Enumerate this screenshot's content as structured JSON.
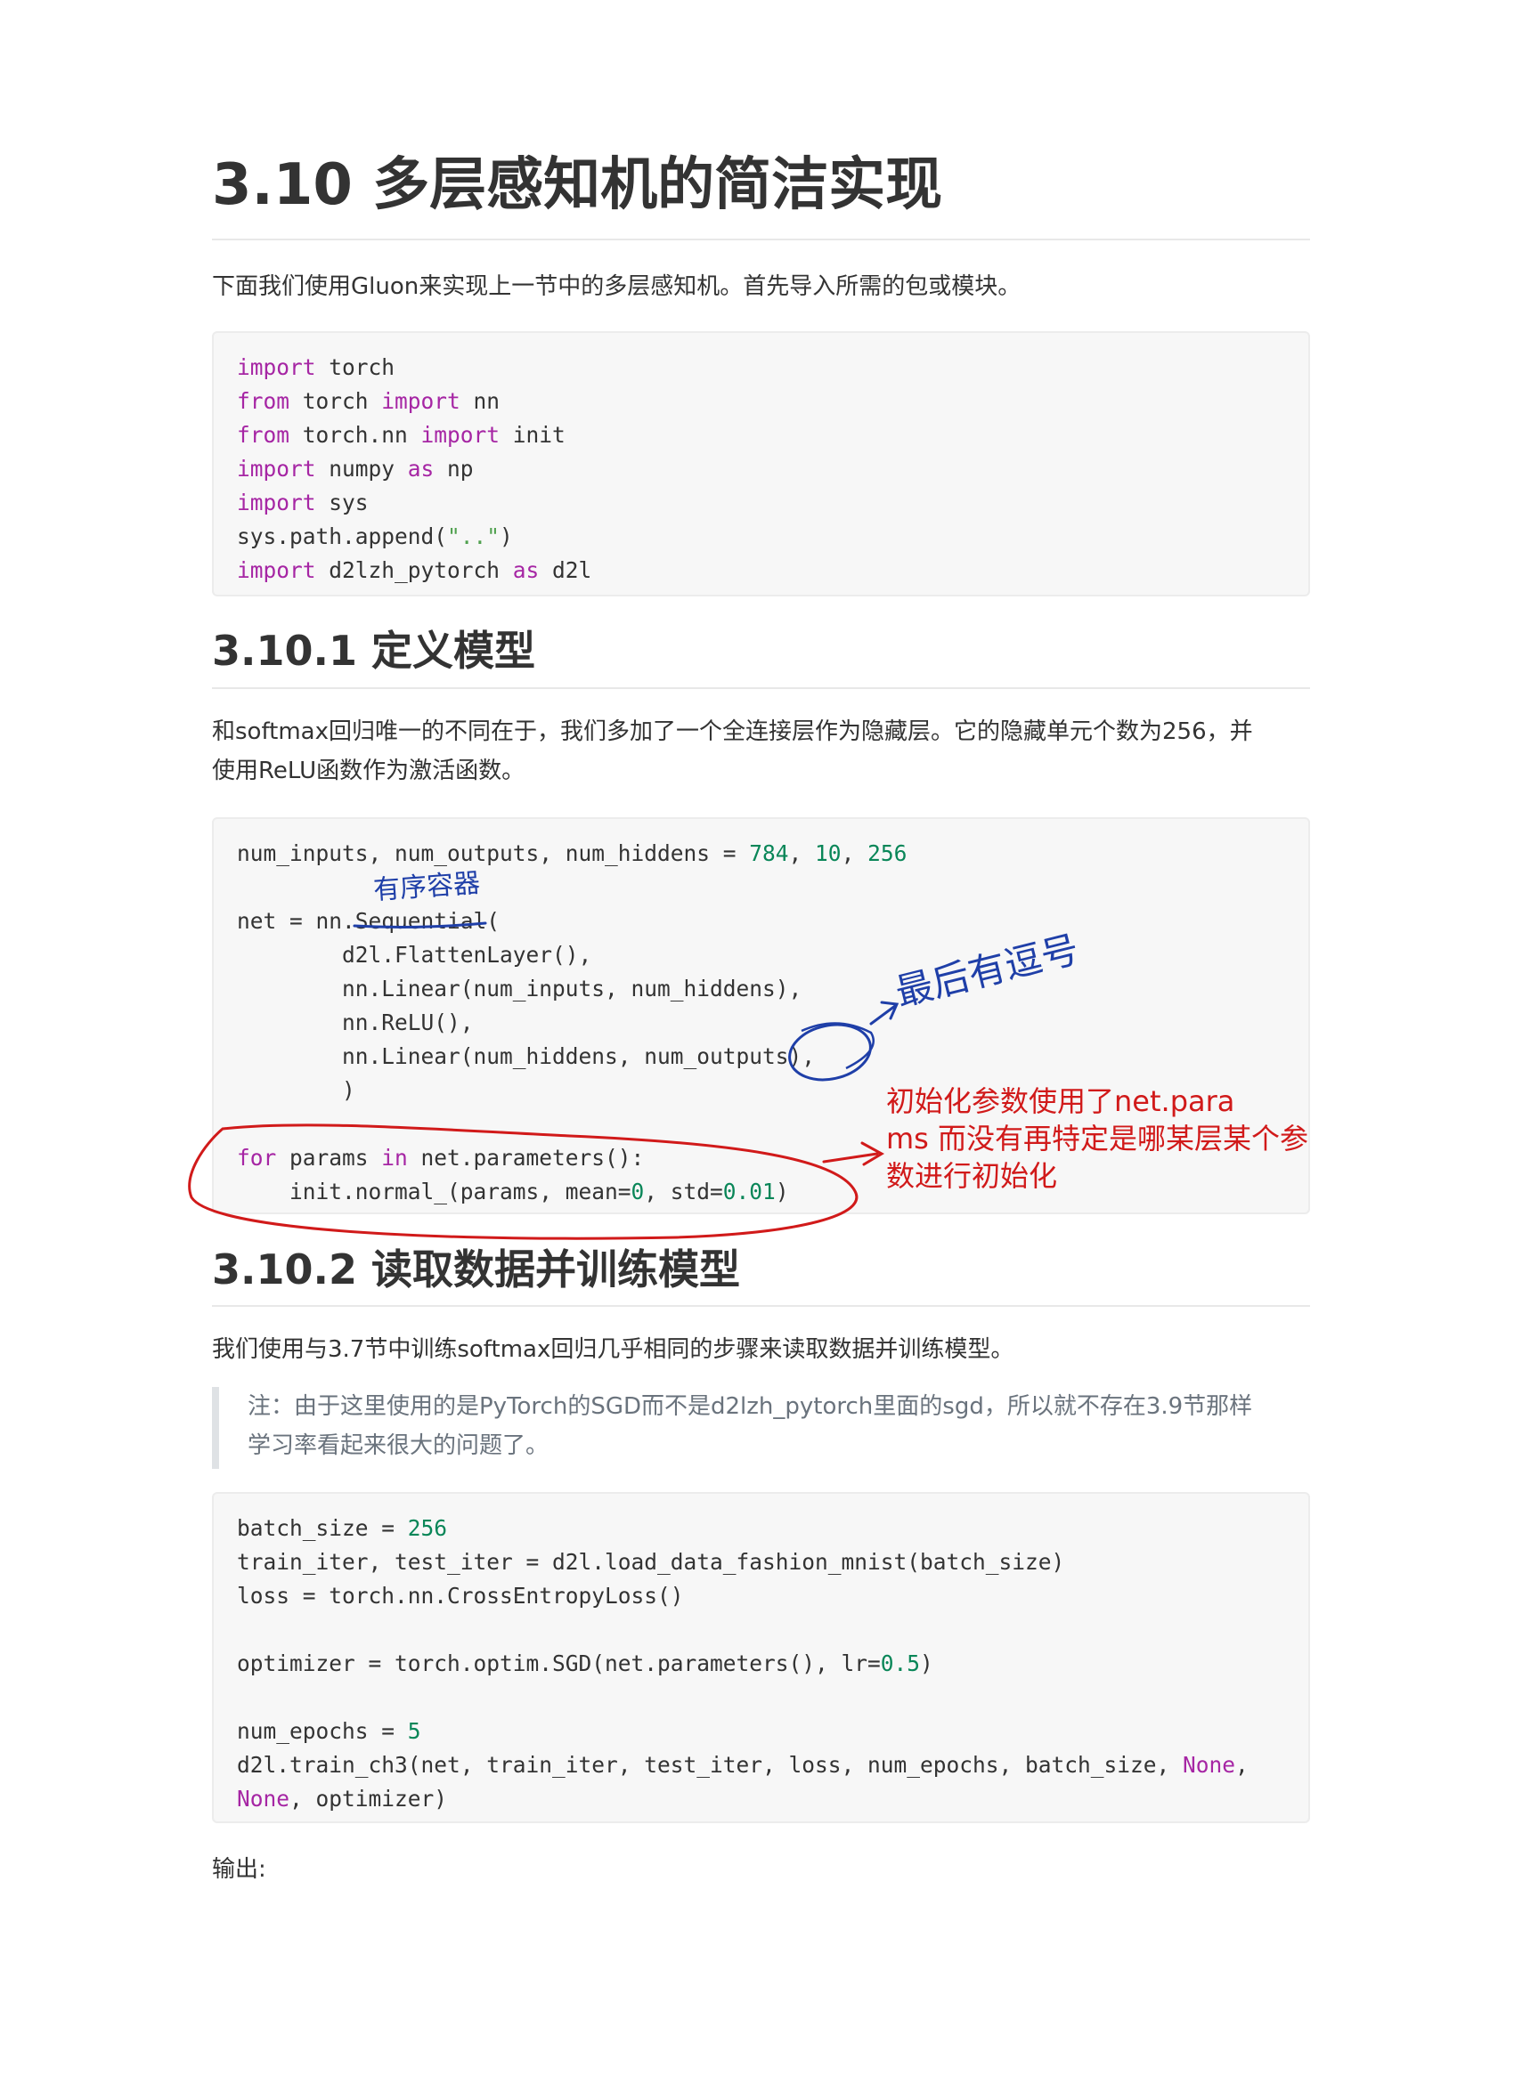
{
  "title": "3.10 多层感知机的简洁实现",
  "intro": "下面我们使用Gluon来实现上一节中的多层感知机。首先导入所需的包或模块。",
  "code_imports": [
    [
      {
        "t": "import",
        "c": "kw"
      },
      {
        "t": " torch"
      }
    ],
    [
      {
        "t": "from",
        "c": "kw"
      },
      {
        "t": " torch "
      },
      {
        "t": "import",
        "c": "kw"
      },
      {
        "t": " nn"
      }
    ],
    [
      {
        "t": "from",
        "c": "kw"
      },
      {
        "t": " torch.nn "
      },
      {
        "t": "import",
        "c": "kw"
      },
      {
        "t": " init"
      }
    ],
    [
      {
        "t": "import",
        "c": "kw"
      },
      {
        "t": " numpy "
      },
      {
        "t": "as",
        "c": "kw"
      },
      {
        "t": " np"
      }
    ],
    [
      {
        "t": "import",
        "c": "kw"
      },
      {
        "t": " sys"
      }
    ],
    [
      {
        "t": "sys.path.append("
      },
      {
        "t": "\"..\"",
        "c": "str"
      },
      {
        "t": ")"
      }
    ],
    [
      {
        "t": "import",
        "c": "kw"
      },
      {
        "t": " d2lzh_pytorch "
      },
      {
        "t": "as",
        "c": "kw"
      },
      {
        "t": " d2l"
      }
    ]
  ],
  "section1": {
    "heading": "3.10.1 定义模型",
    "text_line1": "和softmax回归唯一的不同在于，我们多加了一个全连接层作为隐藏层。它的隐藏单元个数为256，并",
    "text_line2": "使用ReLU函数作为激活函数。"
  },
  "code_model": [
    [
      {
        "t": "num_inputs, num_outputs, num_hiddens = "
      },
      {
        "t": "784",
        "c": "num"
      },
      {
        "t": ", "
      },
      {
        "t": "10",
        "c": "num"
      },
      {
        "t": ", "
      },
      {
        "t": "256",
        "c": "num"
      }
    ],
    [
      {
        "t": ""
      }
    ],
    [
      {
        "t": "net = nn.Sequential("
      }
    ],
    [
      {
        "t": "        d2l.FlattenLayer(),"
      }
    ],
    [
      {
        "t": "        nn.Linear(num_inputs, num_hiddens),"
      }
    ],
    [
      {
        "t": "        nn.ReLU(),"
      }
    ],
    [
      {
        "t": "        nn.Linear(num_hiddens, num_outputs),"
      }
    ],
    [
      {
        "t": "        )"
      }
    ],
    [
      {
        "t": ""
      }
    ],
    [
      {
        "t": "for",
        "c": "kw"
      },
      {
        "t": " params "
      },
      {
        "t": "in",
        "c": "kw"
      },
      {
        "t": " net.parameters():"
      }
    ],
    [
      {
        "t": "    init.normal_(params, mean="
      },
      {
        "t": "0",
        "c": "num"
      },
      {
        "t": ", std="
      },
      {
        "t": "0.01",
        "c": "num"
      },
      {
        "t": ")"
      }
    ]
  ],
  "section2": {
    "heading": "3.10.2 读取数据并训练模型",
    "text": "我们使用与3.7节中训练softmax回归几乎相同的步骤来读取数据并训练模型。",
    "note_line1": "注：由于这里使用的是PyTorch的SGD而不是d2lzh_pytorch里面的sgd，所以就不存在3.9节那样",
    "note_line2": "学习率看起来很大的问题了。"
  },
  "code_train": [
    [
      {
        "t": "batch_size = "
      },
      {
        "t": "256",
        "c": "num"
      }
    ],
    [
      {
        "t": "train_iter, test_iter = d2l.load_data_fashion_mnist(batch_size)"
      }
    ],
    [
      {
        "t": "loss = torch.nn.CrossEntropyLoss()"
      }
    ],
    [
      {
        "t": ""
      }
    ],
    [
      {
        "t": "optimizer = torch.optim.SGD(net.parameters(), lr="
      },
      {
        "t": "0.5",
        "c": "num"
      },
      {
        "t": ")"
      }
    ],
    [
      {
        "t": ""
      }
    ],
    [
      {
        "t": "num_epochs = "
      },
      {
        "t": "5",
        "c": "num"
      }
    ],
    [
      {
        "t": "d2l.train_ch3(net, train_iter, test_iter, loss, num_epochs, batch_size, "
      },
      {
        "t": "None",
        "c": "kw"
      },
      {
        "t": ","
      }
    ],
    [
      {
        "t": "None",
        "c": "kw"
      },
      {
        "t": ", optimizer)"
      }
    ]
  ],
  "output_label": "输出:",
  "handwriting": {
    "annotation_sequential": "有序容器",
    "annotation_comma": "最后有逗号",
    "annotation_init": "初始化参数使用了net.params 而没有再特定是哪某层某个参数进行初始化"
  },
  "colors": {
    "text": "#333333",
    "code_bg": "#f7f7f7",
    "keyword": "#a626a4",
    "number": "#098658",
    "ink_blue": "#1f3fa8",
    "ink_red": "#d11a1a"
  }
}
